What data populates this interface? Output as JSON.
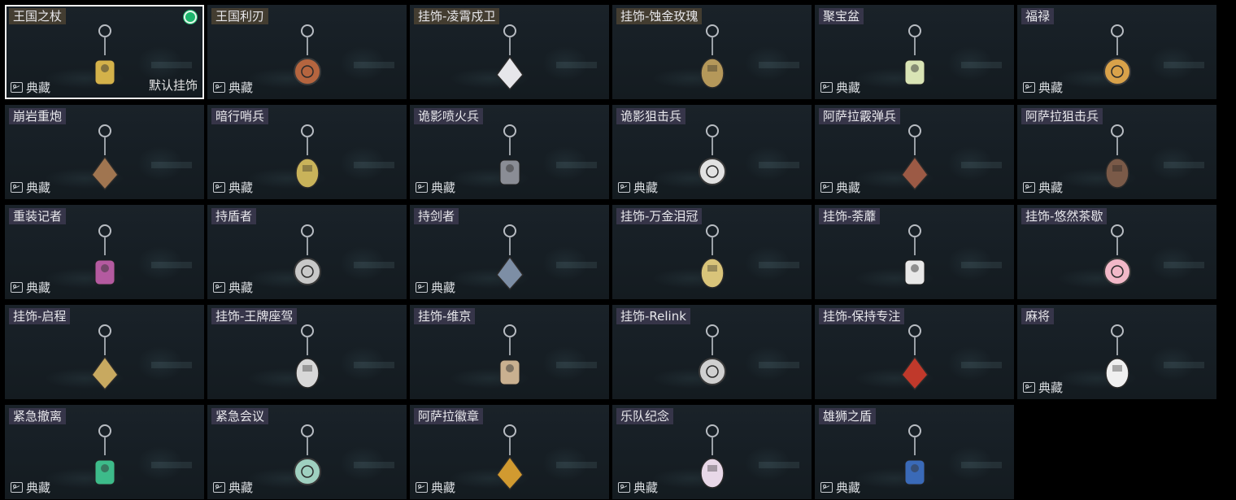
{
  "collection_label": "典藏",
  "default_label": "默认挂饰",
  "items": [
    {
      "name": "王国之杖",
      "tag_style": "gold",
      "collection": true,
      "selected": true,
      "equipped": true,
      "default": true,
      "icon": "scepter-charm-icon",
      "color": "#d4b24a"
    },
    {
      "name": "王国利刃",
      "tag_style": "gold",
      "collection": true,
      "icon": "knight-charm-icon",
      "color": "#b5653f"
    },
    {
      "name": "挂饰-凌霄戍卫",
      "tag_style": "gold",
      "collection": false,
      "icon": "rocket-charm-icon",
      "color": "#e6e6ea"
    },
    {
      "name": "挂饰-蚀金玫瑰",
      "tag_style": "gold",
      "collection": false,
      "icon": "rose-medal-charm-icon",
      "color": "#b5985a"
    },
    {
      "name": "聚宝盆",
      "tag_style": "purple",
      "collection": true,
      "icon": "treasure-bowl-charm-icon",
      "color": "#d9e4b5"
    },
    {
      "name": "福禄",
      "tag_style": "purple",
      "collection": true,
      "icon": "gourd-charm-icon",
      "color": "#d9a24a"
    },
    {
      "name": "崩岩重炮",
      "tag_style": "purple",
      "collection": true,
      "icon": "cannon-figure-charm-icon",
      "color": "#a07550"
    },
    {
      "name": "暗行哨兵",
      "tag_style": "purple",
      "collection": true,
      "icon": "sentry-figure-charm-icon",
      "color": "#c9b35a"
    },
    {
      "name": "诡影喷火兵",
      "tag_style": "purple",
      "collection": true,
      "icon": "flamethrower-figure-charm-icon",
      "color": "#8a8d95"
    },
    {
      "name": "诡影狙击兵",
      "tag_style": "purple",
      "collection": true,
      "icon": "sniper-figure-charm-icon",
      "color": "#e2e2e2"
    },
    {
      "name": "阿萨拉霰弹兵",
      "tag_style": "purple",
      "collection": true,
      "icon": "shotgunner-figure-charm-icon",
      "color": "#9c5a45"
    },
    {
      "name": "阿萨拉狙击兵",
      "tag_style": "purple",
      "collection": true,
      "icon": "asala-sniper-figure-charm-icon",
      "color": "#7a5a48"
    },
    {
      "name": "重装记者",
      "tag_style": "purple",
      "collection": true,
      "icon": "reporter-figure-charm-icon",
      "color": "#b45aa0"
    },
    {
      "name": "持盾者",
      "tag_style": "purple",
      "collection": true,
      "icon": "shield-bearer-figure-charm-icon",
      "color": "#c8c8c8"
    },
    {
      "name": "持剑者",
      "tag_style": "purple",
      "collection": true,
      "icon": "swordsman-figure-charm-icon",
      "color": "#7d8ea5"
    },
    {
      "name": "挂饰-万金泪冠",
      "tag_style": "purple",
      "collection": false,
      "icon": "crown-charm-icon",
      "color": "#d9c47a"
    },
    {
      "name": "挂饰-荼蘼",
      "tag_style": "purple",
      "collection": false,
      "icon": "flower-charm-icon",
      "color": "#e8e8e8"
    },
    {
      "name": "挂饰-悠然茶歇",
      "tag_style": "purple",
      "collection": false,
      "icon": "cupcake-charm-icon",
      "color": "#f2b8c8"
    },
    {
      "name": "挂饰-启程",
      "tag_style": "purple",
      "collection": false,
      "icon": "compass-charm-icon",
      "color": "#c8a960"
    },
    {
      "name": "挂饰-王牌座驾",
      "tag_style": "purple",
      "collection": false,
      "icon": "jet-charm-icon",
      "color": "#d8d8d8"
    },
    {
      "name": "挂饰-维京",
      "tag_style": "purple",
      "collection": false,
      "icon": "hammer-charm-icon",
      "color": "#c9b090"
    },
    {
      "name": "挂饰-Relink",
      "tag_style": "purple",
      "collection": false,
      "icon": "relink-emblem-charm-icon",
      "color": "#d0d0d0"
    },
    {
      "name": "挂饰-保持专注",
      "tag_style": "purple",
      "collection": false,
      "icon": "stay-focused-tag-charm-icon",
      "color": "#c0392b"
    },
    {
      "name": "麻将",
      "tag_style": "purple",
      "collection": true,
      "icon": "mahjong-tile-charm-icon",
      "color": "#f0f0f0"
    },
    {
      "name": "紧急撤离",
      "tag_style": "purple",
      "collection": true,
      "icon": "evac-sign-charm-icon",
      "color": "#3dbb8a"
    },
    {
      "name": "紧急会议",
      "tag_style": "purple",
      "collection": true,
      "icon": "meeting-badge-charm-icon",
      "color": "#9fd0c0"
    },
    {
      "name": "阿萨拉徽章",
      "tag_style": "purple",
      "collection": true,
      "icon": "asala-badge-charm-icon",
      "color": "#d19a30"
    },
    {
      "name": "乐队纪念",
      "tag_style": "purple",
      "collection": true,
      "icon": "band-pin-charm-icon",
      "color": "#e8d8e8"
    },
    {
      "name": "雄狮之盾",
      "tag_style": "purple",
      "collection": true,
      "icon": "lion-shield-charm-icon",
      "color": "#3a6ab8"
    }
  ]
}
